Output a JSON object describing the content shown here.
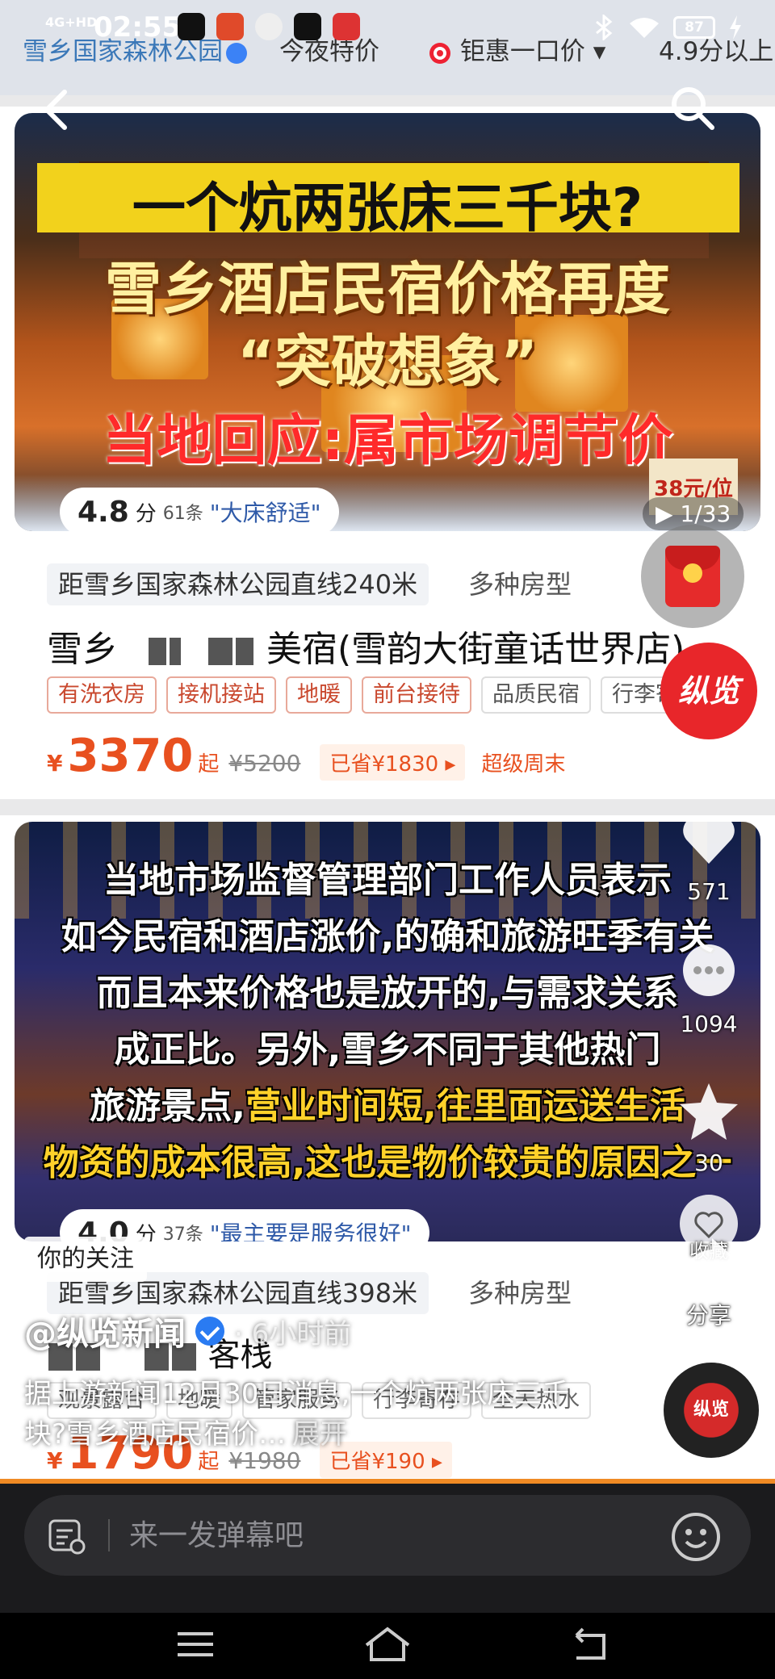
{
  "status_bar": {
    "time": "02:55",
    "network": "4G+HD",
    "battery": "87"
  },
  "app_strip": {
    "tabs": [
      "雪乡国家森林公园",
      "今夜特价",
      "钜惠一口价",
      "4.9分以上"
    ]
  },
  "listing1": {
    "headline1": "一个炕两张床三千块?",
    "headline2": "雪乡酒店民宿价格再度",
    "headline3": "“突破想象”",
    "headline4": "当地回应:属市场调节价",
    "price_sign": "38元/位",
    "rating": "4.8",
    "rating_unit": "分",
    "review_count": "61条",
    "review_quote": "\"大床舒适\"",
    "image_counter": "▶ 1/33",
    "distance": "距雪乡国家森林公园直线240米",
    "room_type": "多种房型",
    "name_prefix": "雪乡",
    "name_suffix": "美宿(雪韵大街童话世界店)",
    "tags": [
      "有洗衣房",
      "接机接站",
      "地暖",
      "前台接待",
      "品质民宿",
      "行李寄存"
    ],
    "currency": "¥",
    "price": "3370",
    "price_qi": "起",
    "old_price": "¥5200",
    "saved": "已省¥1830 ▸",
    "promo": "超级周末"
  },
  "listing2": {
    "caption": [
      {
        "text": "当地市场监督管理部门工作人员表示",
        "hl": ""
      },
      {
        "text": "如今民宿和酒店涨价,的确和旅游旺季有关",
        "hl": ""
      },
      {
        "text": "而且本来价格也是放开的,与需求关系",
        "hl": ""
      },
      {
        "text": "成正比。另外,雪乡不同于其他热门",
        "hl": ""
      },
      {
        "text": "旅游景点,",
        "hl": "营业时间短,往里面运送生活"
      },
      {
        "text": "",
        "hl": "物资的成本很高,这也是物价较贵的原因之一"
      }
    ],
    "rating": "4.0",
    "rating_unit": "分",
    "review_count": "37条",
    "review_quote": "\"最主要是服务很好\"",
    "distance": "距雪乡国家森林公园直线398米",
    "room_type": "多种房型",
    "name_suffix": "客栈",
    "tags": [
      "观景露台",
      "地暖",
      "管家服务",
      "行李寄存",
      "全天热水"
    ],
    "price": "1790",
    "old_price": "¥1980",
    "saved": "已省¥190 ▸"
  },
  "actions": {
    "like_count": "571",
    "comment_count": "1094",
    "favorite_count": "30",
    "favorite_hint": "收藏",
    "share_label": "分享",
    "avatar_text": "纵览",
    "disc_text": "纵览"
  },
  "author": {
    "follow_badge": "你的关注",
    "name": "@纵览新闻",
    "time": "· 6小时前"
  },
  "description": {
    "text": "据上游新闻12月30日消息,一个炕两张床三千块?雪乡酒店民宿价…",
    "expand": "展开"
  },
  "comment_bar": {
    "placeholder": "来一发弹幕吧"
  },
  "colors": {
    "accent": "#e8501f",
    "progress": "#f08a24",
    "red": "#e8262a"
  }
}
